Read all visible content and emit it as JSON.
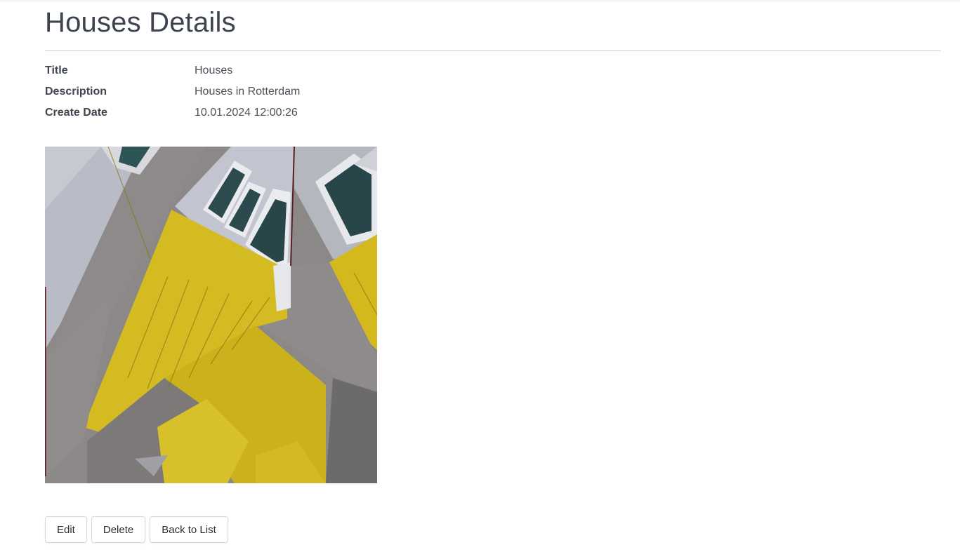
{
  "page": {
    "title": "Houses Details"
  },
  "details": [
    {
      "term": "Title",
      "value": "Houses"
    },
    {
      "term": "Description",
      "value": "Houses in Rotterdam"
    },
    {
      "term": "Create Date",
      "value": "10.01.2024 12:00:26"
    }
  ],
  "image": {
    "subject": "yellow cube houses photo"
  },
  "actions": {
    "edit_label": "Edit",
    "delete_label": "Delete",
    "back_label": "Back to List"
  }
}
